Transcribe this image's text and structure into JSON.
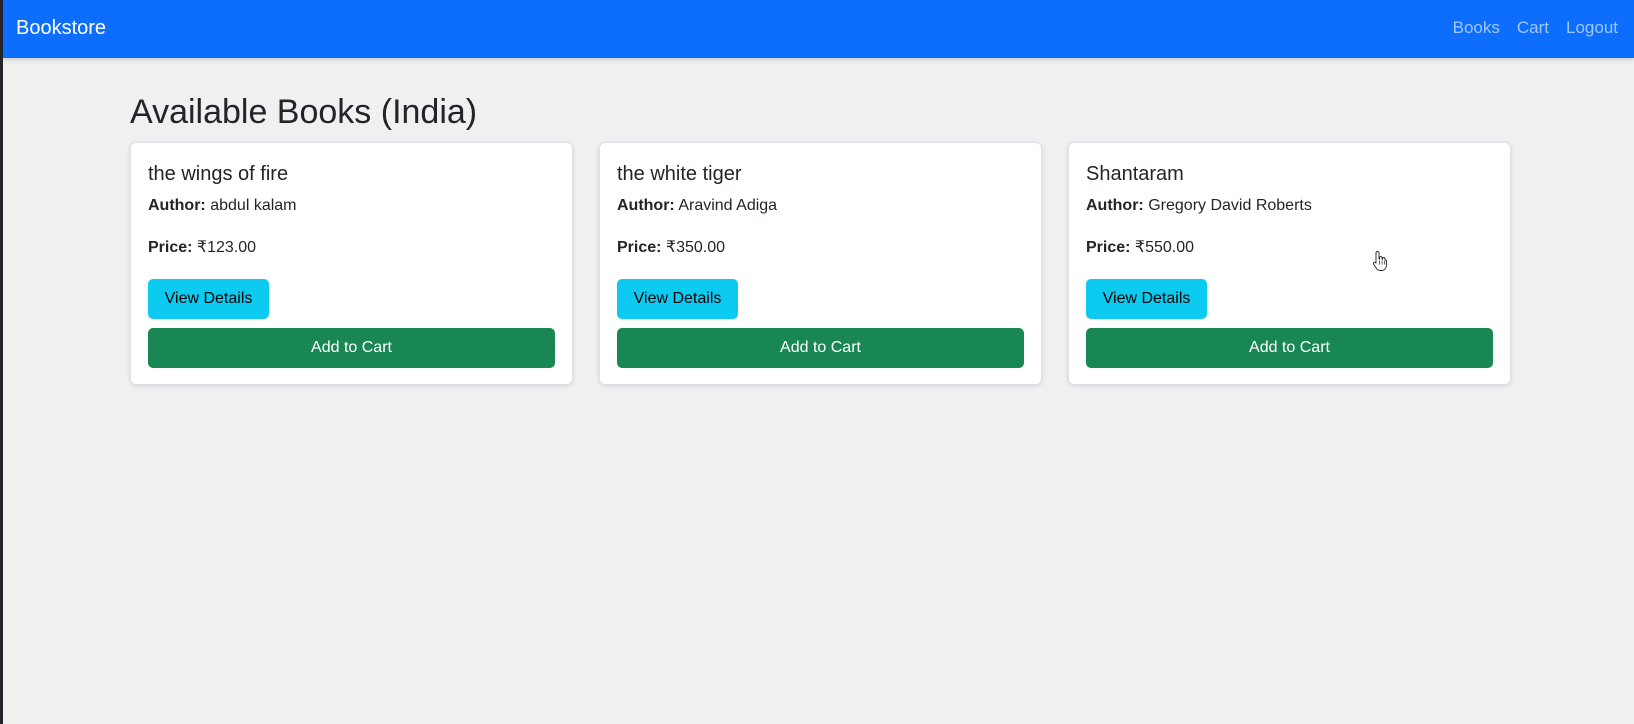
{
  "navbar": {
    "brand": "Bookstore",
    "links": [
      "Books",
      "Cart",
      "Logout"
    ],
    "bg_color": "#0d6efd"
  },
  "page": {
    "title": "Available Books (India)"
  },
  "labels": {
    "author": "Author:",
    "price": "Price:",
    "view_details": "View Details",
    "add_to_cart": "Add to Cart"
  },
  "books": [
    {
      "title": "the wings of fire",
      "author": "abdul kalam",
      "price": "₹123.00"
    },
    {
      "title": "the white tiger",
      "author": "Aravind Adiga",
      "price": "₹350.00"
    },
    {
      "title": "Shantaram",
      "author": "Gregory David Roberts",
      "price": "₹550.00"
    }
  ],
  "colors": {
    "details_button": "#0dcaf0",
    "cart_button": "#198754",
    "page_bg": "#f0f0f0"
  },
  "icons": {
    "cursor": "hand-pointer-icon"
  }
}
